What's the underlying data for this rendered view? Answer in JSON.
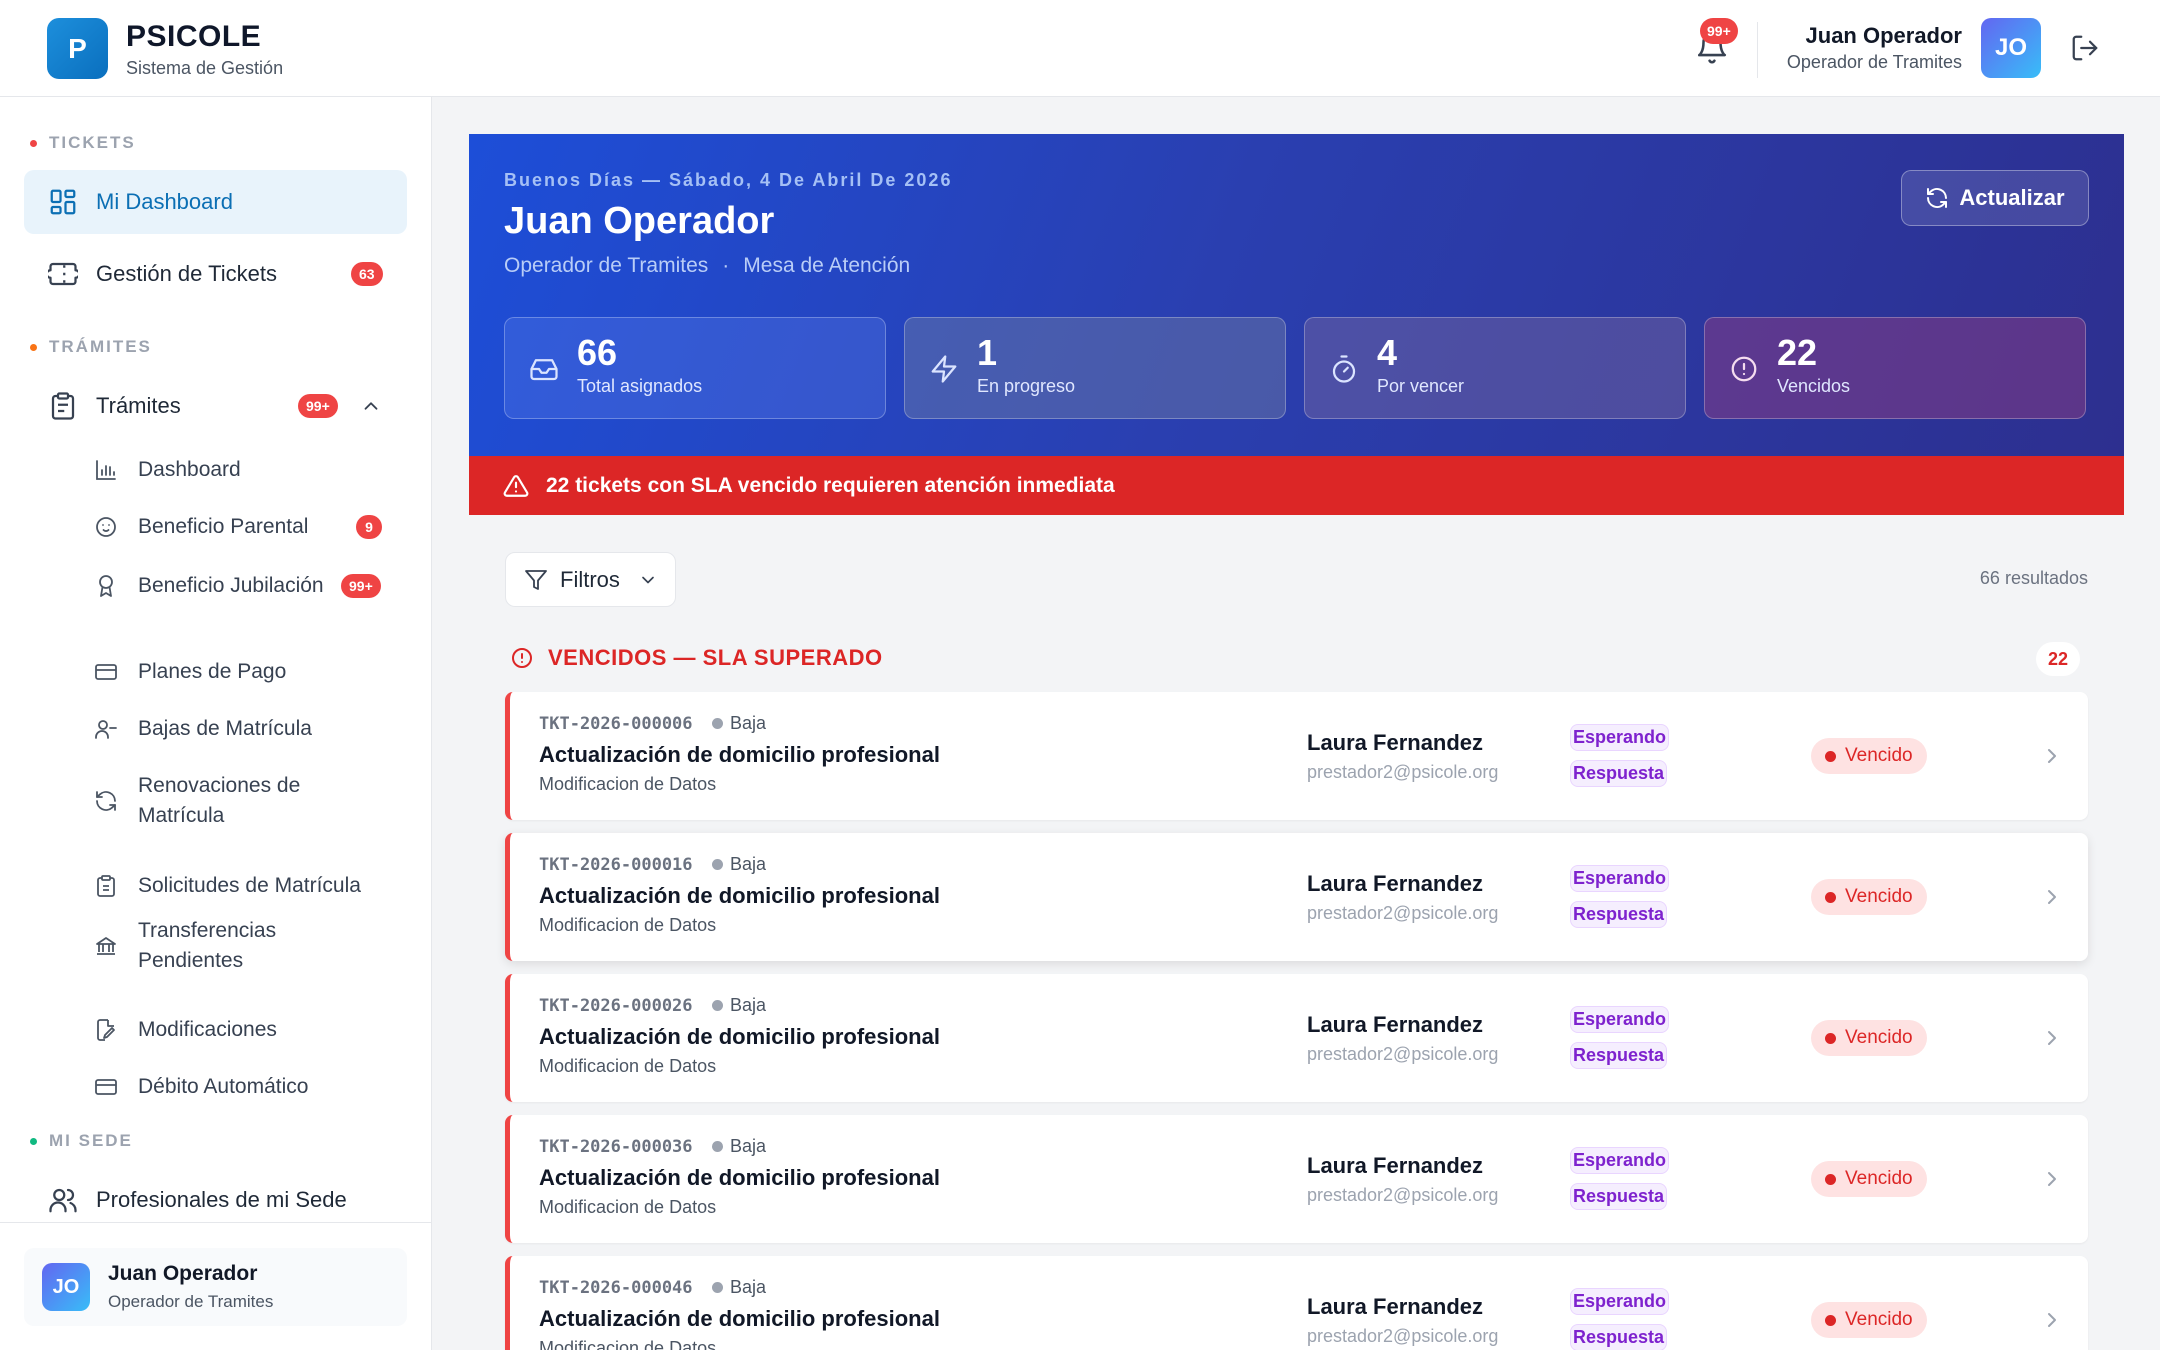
{
  "header": {
    "logo_letter": "P",
    "brand": "PSICOLE",
    "brand_sub": "Sistema de Gestión",
    "notif_badge": "99+",
    "user_name": "Juan Operador",
    "user_role": "Operador de Tramites",
    "avatar": "JO"
  },
  "sidebar": {
    "sections": [
      {
        "label": "TICKETS",
        "color": "#ef4444"
      },
      {
        "label": "TRÁMITES",
        "color": "#f97316"
      },
      {
        "label": "MI SEDE",
        "color": "#10b981"
      }
    ],
    "items": [
      {
        "label": "Mi Dashboard",
        "icon": "grid-icon"
      },
      {
        "label": "Gestión de Tickets",
        "icon": "ticket-icon",
        "badge": "63"
      },
      {
        "label": "Trámites",
        "icon": "clipboard-icon",
        "badge": "99+"
      },
      {
        "label": "Profesionales de mi Sede",
        "icon": "users-icon"
      }
    ],
    "sub_items": [
      {
        "label": "Dashboard",
        "icon": "bar-chart-icon"
      },
      {
        "label": "Beneficio Parental",
        "icon": "baby-icon",
        "badge": "9"
      },
      {
        "label": "Beneficio Jubilación",
        "icon": "award-icon",
        "badge": "99+"
      },
      {
        "label": "Planes de Pago",
        "icon": "credit-card-icon"
      },
      {
        "label": "Bajas de Matrícula",
        "icon": "user-minus-icon"
      },
      {
        "label": "Renovaciones de Matrícula",
        "icon": "refresh-icon"
      },
      {
        "label": "Solicitudes de Matrícula",
        "icon": "clipboard-list-icon"
      },
      {
        "label": "Transferencias Pendientes",
        "icon": "bank-icon"
      },
      {
        "label": "Modificaciones",
        "icon": "file-edit-icon"
      },
      {
        "label": "Débito Automático",
        "icon": "credit-card-icon"
      }
    ],
    "footer": {
      "avatar": "JO",
      "name": "Juan Operador",
      "role": "Operador de Tramites"
    }
  },
  "hero": {
    "greeting": "Buenos Días — Sábado, 4 De Abril De 2026",
    "name": "Juan Operador",
    "role": "Operador de Tramites",
    "separator": "·",
    "area": "Mesa de Atención",
    "refresh_label": "Actualizar",
    "stats": [
      {
        "value": "66",
        "label": "Total asignados",
        "icon": "inbox-icon"
      },
      {
        "value": "1",
        "label": "En progreso",
        "icon": "bolt-icon"
      },
      {
        "value": "4",
        "label": "Por vencer",
        "icon": "timer-icon"
      },
      {
        "value": "22",
        "label": "Vencidos",
        "icon": "alert-circle-icon"
      }
    ]
  },
  "alert": {
    "text": "22 tickets con SLA vencido requieren atención inmediata"
  },
  "filters": {
    "label": "Filtros",
    "results": "66 resultados"
  },
  "group": {
    "title": "VENCIDOS — SLA SUPERADO",
    "count": "22"
  },
  "tickets": [
    {
      "code": "TKT-2026-000006",
      "priority": "Baja",
      "title": "Actualización de domicilio profesional",
      "category": "Modificacion de Datos",
      "person": "Laura Fernandez",
      "email": "prestador2@psicole.org",
      "status_line1": "Esperando",
      "status_line2": "Respuesta",
      "sla": "Vencido"
    },
    {
      "code": "TKT-2026-000016",
      "priority": "Baja",
      "title": "Actualización de domicilio profesional",
      "category": "Modificacion de Datos",
      "person": "Laura Fernandez",
      "email": "prestador2@psicole.org",
      "status_line1": "Esperando",
      "status_line2": "Respuesta",
      "sla": "Vencido"
    },
    {
      "code": "TKT-2026-000026",
      "priority": "Baja",
      "title": "Actualización de domicilio profesional",
      "category": "Modificacion de Datos",
      "person": "Laura Fernandez",
      "email": "prestador2@psicole.org",
      "status_line1": "Esperando",
      "status_line2": "Respuesta",
      "sla": "Vencido"
    },
    {
      "code": "TKT-2026-000036",
      "priority": "Baja",
      "title": "Actualización de domicilio profesional",
      "category": "Modificacion de Datos",
      "person": "Laura Fernandez",
      "email": "prestador2@psicole.org",
      "status_line1": "Esperando",
      "status_line2": "Respuesta",
      "sla": "Vencido"
    },
    {
      "code": "TKT-2026-000046",
      "priority": "Baja",
      "title": "Actualización de domicilio profesional",
      "category": "Modificacion de Datos",
      "person": "Laura Fernandez",
      "email": "prestador2@psicole.org",
      "status_line1": "Esperando",
      "status_line2": "Respuesta",
      "sla": "Vencido"
    }
  ]
}
